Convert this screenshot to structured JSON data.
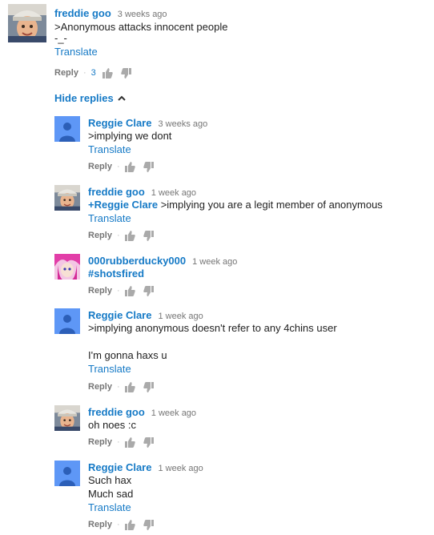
{
  "main_comment": {
    "author": "freddie goo",
    "time": "3 weeks ago",
    "lines": [
      ">Anonymous attacks innocent people",
      "-_-"
    ],
    "translate": "Translate",
    "reply": "Reply",
    "likes": "3"
  },
  "hide_replies": "Hide replies",
  "replies": [
    {
      "author": "Reggie Clare",
      "time": "3 weeks ago",
      "text": ">implying we dont",
      "translate": "Translate",
      "reply": "Reply"
    },
    {
      "author": "freddie goo",
      "time": "1 week ago",
      "mention": "+Reggie Clare",
      "text": " >implying you are a legit member of anonymous",
      "translate": "Translate",
      "reply": "Reply"
    },
    {
      "author": "000rubberducky000",
      "time": "1 week ago",
      "hashtag": "#shotsfired",
      "reply": "Reply"
    },
    {
      "author": "Reggie Clare",
      "time": "1 week ago",
      "text": ">implying anonymous doesn't refer to any 4chins user\n\nI'm gonna haxs u",
      "translate": "Translate",
      "reply": "Reply"
    },
    {
      "author": "freddie goo",
      "time": "1 week ago",
      "text": "oh noes :c",
      "reply": "Reply"
    },
    {
      "author": "Reggie Clare",
      "time": "1 week ago",
      "text": "Such hax\nMuch sad",
      "translate": "Translate",
      "reply": "Reply"
    }
  ],
  "colors": {
    "link": "#167ac6",
    "meta": "#767676",
    "default_avatar": "#5e97f6"
  },
  "icons": [
    "thumbs-up-icon",
    "thumbs-down-icon",
    "chevron-up-icon",
    "default-avatar-icon"
  ]
}
